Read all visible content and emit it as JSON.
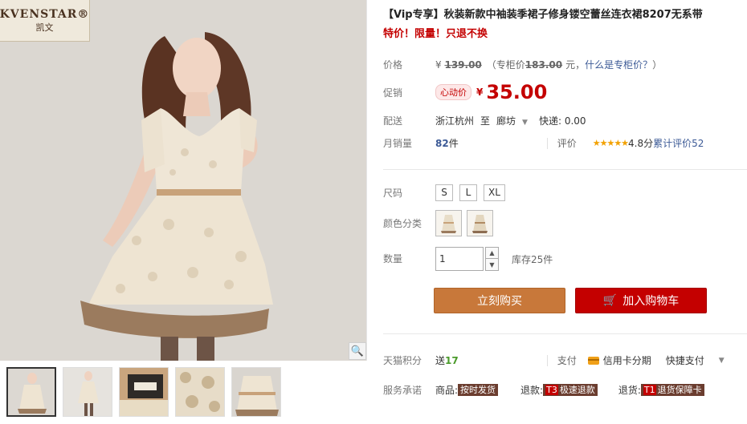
{
  "brand": {
    "logo_text": "KVENSTAR®",
    "logo_sub": "凯文"
  },
  "gallery": {
    "thumbnail_count": 5,
    "active_index": 0,
    "zoom_icon": "magnifier-icon"
  },
  "product": {
    "title": "【Vip专享】秋装新款中袖装季裙子修身镂空蕾丝连衣裙8207无系带",
    "subtitle": "特价！限量！只退不换"
  },
  "price": {
    "label": "价格",
    "yen": "¥",
    "original": "139.00",
    "counter_prefix": "（专柜价",
    "counter_price": "183.00",
    "counter_suffix": "元，",
    "counter_link": "什么是专柜价？",
    "counter_close": "）"
  },
  "promo": {
    "label": "促销",
    "badge": "心动价",
    "yen": "¥",
    "price": "35.00"
  },
  "shipping": {
    "label": "配送",
    "from": "浙江杭州",
    "to_word": "至",
    "to": "廊坊",
    "method": "快递: 0.00"
  },
  "sales": {
    "label": "月销量",
    "count": "82",
    "unit": "件",
    "rating_label": "评价",
    "stars": "★★★★★",
    "score": "4.8分",
    "reviews_prefix": "累计评价",
    "reviews_count": "52"
  },
  "options": {
    "size_label": "尺码",
    "sizes": [
      "S",
      "L",
      "XL"
    ],
    "color_label": "颜色分类",
    "color_count": 2,
    "qty_label": "数量",
    "qty_value": "1",
    "stock": "库存25件"
  },
  "actions": {
    "buy": "立刻购买",
    "cart": "加入购物车"
  },
  "points": {
    "label": "天猫积分",
    "send": "送",
    "value": "17",
    "pay_label": "支付",
    "installment": "信用卡分期",
    "quick": "快捷支付"
  },
  "service": {
    "label": "服务承诺",
    "goods_label": "商品:",
    "goods_tag": "按时发货",
    "refund_label": "退款:",
    "refund_code": "T3",
    "refund_tag": "极速退款",
    "return_label": "退货:",
    "return_code": "T1",
    "return_tag": "退货保障卡"
  },
  "colors": {
    "price_red": "#c40000",
    "buy_orange": "#c8783a",
    "link_blue": "#3c5a96"
  }
}
